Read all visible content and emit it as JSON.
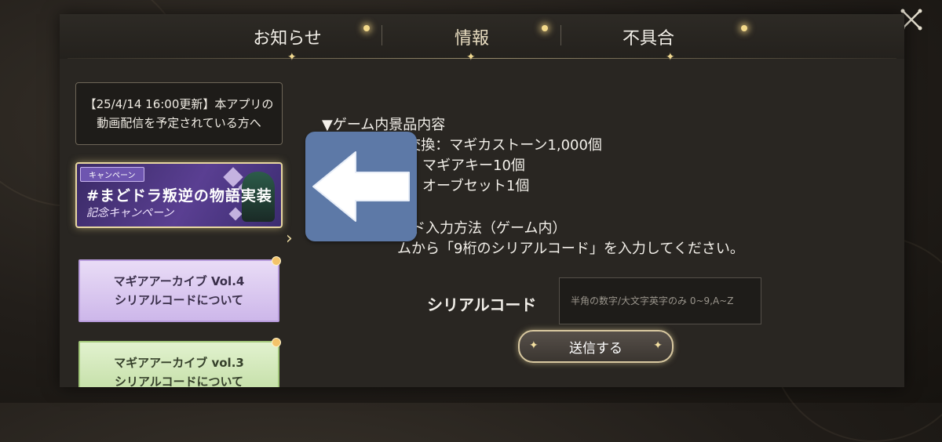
{
  "tabs": [
    {
      "label": "お知らせ",
      "active": false
    },
    {
      "label": "情報",
      "active": true
    },
    {
      "label": "不具合",
      "active": false
    }
  ],
  "sidebar": {
    "items": [
      {
        "type": "text",
        "label": "【25/4/14 16:00更新】本アプリの動画配信を予定されている方へ"
      },
      {
        "type": "campaign",
        "tag": "キャンペーン",
        "title": "#まどドラ叛逆の物語実装",
        "subtitle": "記念キャンペーン",
        "selected": true
      },
      {
        "type": "archive",
        "line1": "マギアアーカイブ Vol.4",
        "line2": "シリアルコードについて",
        "color": "#cdb7ea"
      },
      {
        "type": "archive",
        "line1": "マギアアーカイブ vol.3",
        "line2": "シリアルコードについて",
        "color": "#bedb9f"
      }
    ]
  },
  "content": {
    "lines": [
      "▼ゲーム内景品内容",
      "・1000ptで交換：マギカストーン1,000個",
      "換：マギアキー10個",
      "換：オーブセット1個",
      "ード入力方法（ゲーム内）",
      "ムから「9桁のシリアルコード」を入力してください。"
    ],
    "serial_label": "シリアルコード",
    "serial_placeholder": "半角の数字/大文字英字のみ 0~9,A~Z",
    "submit_label": "送信する"
  },
  "overlay": {
    "icon": "left-arrow-icon",
    "color": "#5d79a7"
  },
  "close_icon": "close-icon"
}
